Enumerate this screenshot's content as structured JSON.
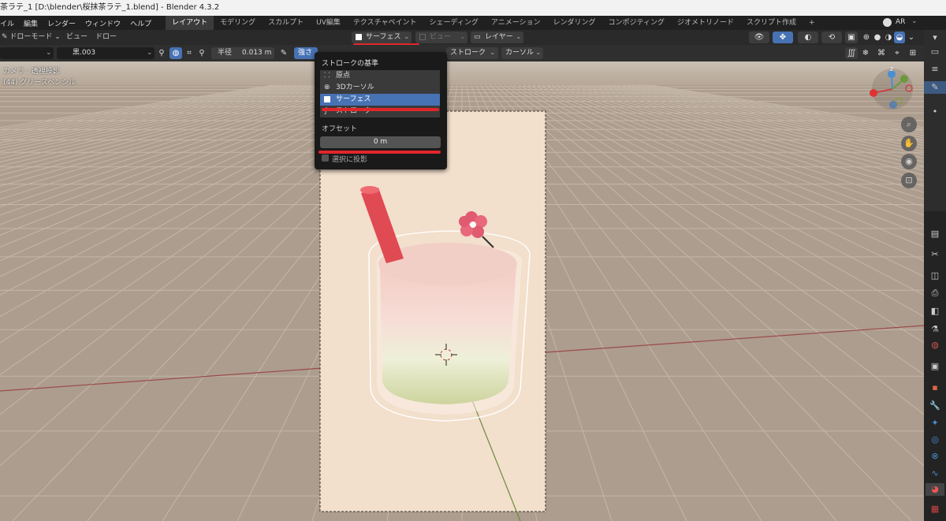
{
  "window": {
    "title": "茶ラテ_1 [D:\\blender\\桜抹茶ラテ_1.blend] - Blender 4.3.2"
  },
  "menus": [
    "イル",
    "編集",
    "レンダー",
    "ウィンドウ",
    "ヘルプ"
  ],
  "workspaces": [
    "レイアウト",
    "モデリング",
    "スカルプト",
    "UV編集",
    "テクスチャペイント",
    "シェーディング",
    "アニメーション",
    "レンダリング",
    "コンポジティング",
    "ジオメトリノード",
    "スクリプト作成"
  ],
  "workspace_add": "+",
  "top_right": {
    "ar_label": "AR"
  },
  "header": {
    "mode": "ドローモード",
    "view_menu": "ビュー",
    "draw_menu": "ドロー",
    "placement_dropdown": "サーフェス",
    "view_dropdown": "ビュー",
    "layer_dropdown": "レイヤー"
  },
  "tool_settings": {
    "material": "黒.003",
    "radius_label": "半径",
    "radius_value": "0.013 m",
    "strength_label": "強さ",
    "stroke_dropdown": "ストローク",
    "cursor_dropdown": "カーソル"
  },
  "viewport_info": {
    "camera": "カメラ : 透視投影",
    "object": "(44) グリースペンシル"
  },
  "popup": {
    "title": "ストロークの基準",
    "items": [
      {
        "label": "原点",
        "icon": "origin-icon",
        "selected": false
      },
      {
        "label": "3Dカーソル",
        "icon": "cursor-3d-icon",
        "selected": false
      },
      {
        "label": "サーフェス",
        "icon": "surface-icon",
        "selected": true
      },
      {
        "label": "ストローク",
        "icon": "stroke-icon",
        "selected": false
      }
    ],
    "offset_label": "オフセット",
    "offset_value": "0 m",
    "project_label": "選択に投影"
  },
  "gizmo": {
    "x": "X",
    "y": "Y",
    "z": "Z"
  },
  "colors": {
    "accent": "#4772b3",
    "highlight_annotation": "#e1262b",
    "floor": "#b0a091",
    "canvas": "#f2dfcc",
    "straw": "#e04a52",
    "axis_x": "#b04040",
    "axis_y": "#6a8a3a"
  }
}
